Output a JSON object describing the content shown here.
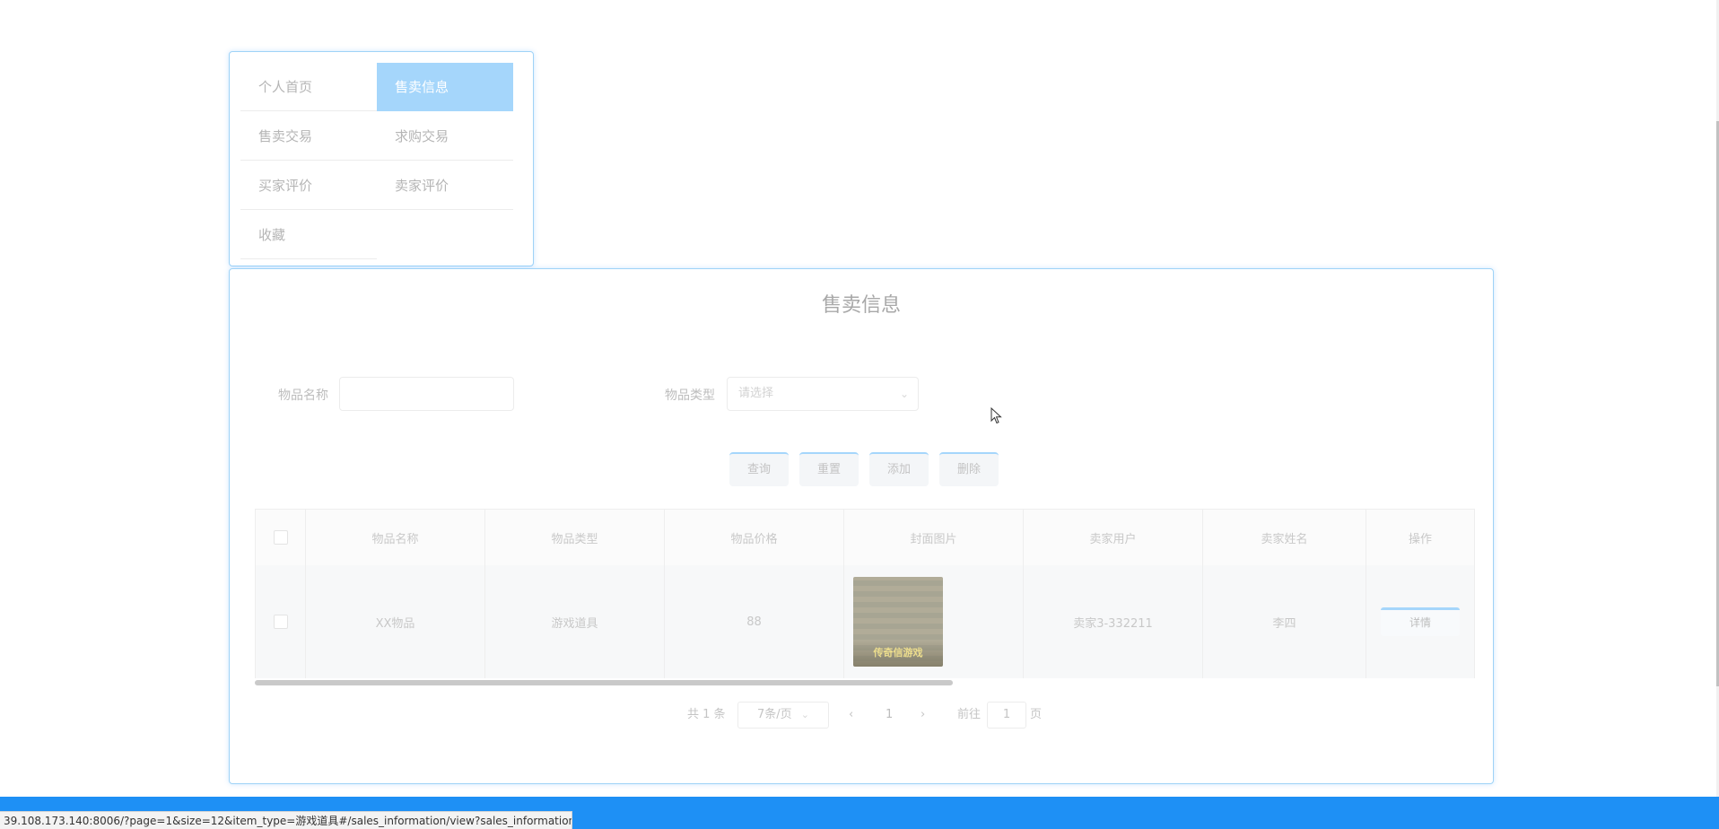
{
  "menu": {
    "items": [
      {
        "label": "个人首页"
      },
      {
        "label": "售卖信息"
      },
      {
        "label": "售卖交易"
      },
      {
        "label": "求购交易"
      },
      {
        "label": "买家评价"
      },
      {
        "label": "卖家评价"
      },
      {
        "label": "收藏"
      }
    ],
    "active_index": 1
  },
  "main": {
    "title": "售卖信息",
    "filters": {
      "name_label": "物品名称",
      "name_value": "",
      "type_label": "物品类型",
      "type_placeholder": "请选择"
    },
    "buttons": {
      "query": "查询",
      "reset": "重置",
      "add": "添加",
      "delete": "删除"
    },
    "table": {
      "headers": [
        "物品名称",
        "物品类型",
        "物品价格",
        "封面图片",
        "卖家用户",
        "卖家姓名",
        "操作"
      ],
      "rows": [
        {
          "name": "XX物品",
          "type": "游戏道具",
          "price": "88",
          "cover_text": "传奇信游戏",
          "seller_user": "卖家3-332211",
          "seller_name": "李四",
          "action": "详情"
        }
      ]
    },
    "pagination": {
      "total": "共 1 条",
      "page_size": "7条/页",
      "prev_icon": "chevron-left-icon",
      "next_icon": "chevron-right-icon",
      "current_page": "1",
      "goto_label": "前往",
      "goto_value": "1",
      "page_suffix": "页"
    }
  },
  "status_bar": {
    "url": "39.108.173.140:8006/?page=1&size=12&item_type=游戏道具#/sales_information/view?sales_information_id..."
  },
  "colors": {
    "accent": "#a5d6fb",
    "bottom_bar": "#1e90f5"
  }
}
